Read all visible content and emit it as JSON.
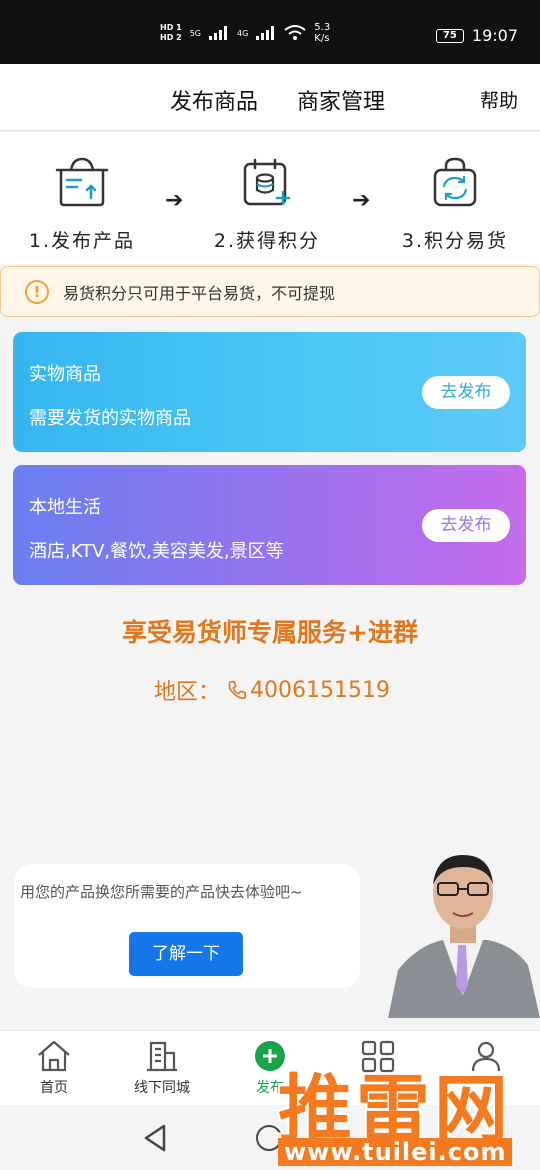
{
  "status_bar": {
    "net_speed_value": "5.3",
    "net_speed_unit": "K/s",
    "battery": "75",
    "time": "19:07",
    "hd1": "HD 1",
    "hd2": "HD 2",
    "net1": "5G",
    "net2": "4G"
  },
  "header": {
    "tab_publish": "发布商品",
    "tab_manage": "商家管理",
    "help": "帮助"
  },
  "steps": [
    {
      "label": "1.发布产品",
      "icon": "upload-box-icon"
    },
    {
      "label": "2.获得积分",
      "icon": "points-calendar-icon"
    },
    {
      "label": "3.积分易货",
      "icon": "exchange-bag-icon"
    }
  ],
  "notice": {
    "text": "易货积分只可用于平台易货，不可提现",
    "color": "#e8a33b"
  },
  "cards": [
    {
      "title": "实物商品",
      "subtitle": "需要发货的实物商品",
      "button": "去发布",
      "color": "#4cc8f4"
    },
    {
      "title": "本地生活",
      "subtitle": "酒店,KTV,餐饮,美容美发,景区等",
      "button": "去发布",
      "color": "#9a72ee"
    }
  ],
  "service": {
    "title": "享受易货师专属服务+进群",
    "region_label": "地区：",
    "phone": "4006151519",
    "color": "#e0781f"
  },
  "promo": {
    "text": "用您的产品换您所需要的产品快去体验吧~",
    "button": "了解一下",
    "button_color": "#1677e8"
  },
  "tabbar": [
    {
      "label": "首页",
      "icon": "home-icon"
    },
    {
      "label": "线下同城",
      "icon": "buildings-icon"
    },
    {
      "label": "发布",
      "icon": "plus-circle-icon"
    },
    {
      "label": "",
      "icon": "grid-icon"
    },
    {
      "label": "",
      "icon": "profile-icon"
    }
  ],
  "watermark": {
    "text": "推雷网",
    "url": "www.tuilei.com"
  }
}
